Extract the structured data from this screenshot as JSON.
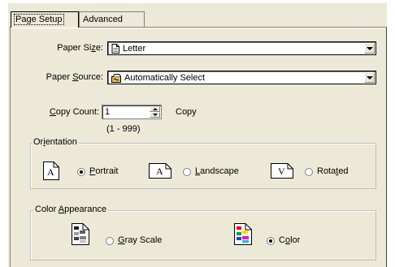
{
  "tabs": [
    {
      "label": "Page Setup",
      "active": true
    },
    {
      "label": "Advanced",
      "active": false
    }
  ],
  "paper_size": {
    "label_pre": "Paper Si",
    "label_u": "z",
    "label_post": "e:",
    "value": "Letter",
    "icon": "page-icon"
  },
  "paper_source": {
    "label_pre": "Paper ",
    "label_u": "S",
    "label_post": "ource:",
    "value": "Automatically Select",
    "icon": "tray-icon"
  },
  "copy_count": {
    "label_pre": "",
    "label_u": "C",
    "label_post": "opy Count:",
    "value": "1",
    "suffix": "Copy",
    "range": "(1 - 999)"
  },
  "orientation": {
    "title_pre": "Or",
    "title_u": "i",
    "title_post": "entation",
    "options": [
      {
        "pre": "",
        "u": "P",
        "post": "ortrait",
        "glyph": "A",
        "selected": true
      },
      {
        "pre": "",
        "u": "L",
        "post": "andscape",
        "glyph": "A",
        "selected": false
      },
      {
        "pre": "Rota",
        "u": "t",
        "post": "ed",
        "glyph": "V",
        "selected": false
      }
    ]
  },
  "color_appearance": {
    "title_pre": "Color ",
    "title_u": "A",
    "title_post": "ppearance",
    "options": [
      {
        "pre": "",
        "u": "G",
        "post": "ray Scale",
        "icon": "grayscale-icon",
        "selected": false
      },
      {
        "pre": "C",
        "u": "o",
        "post": "lor",
        "icon": "color-icon",
        "selected": true
      }
    ]
  },
  "colors": {
    "dialog_bg": "#ece9d8",
    "selection_dot": "#000000"
  }
}
